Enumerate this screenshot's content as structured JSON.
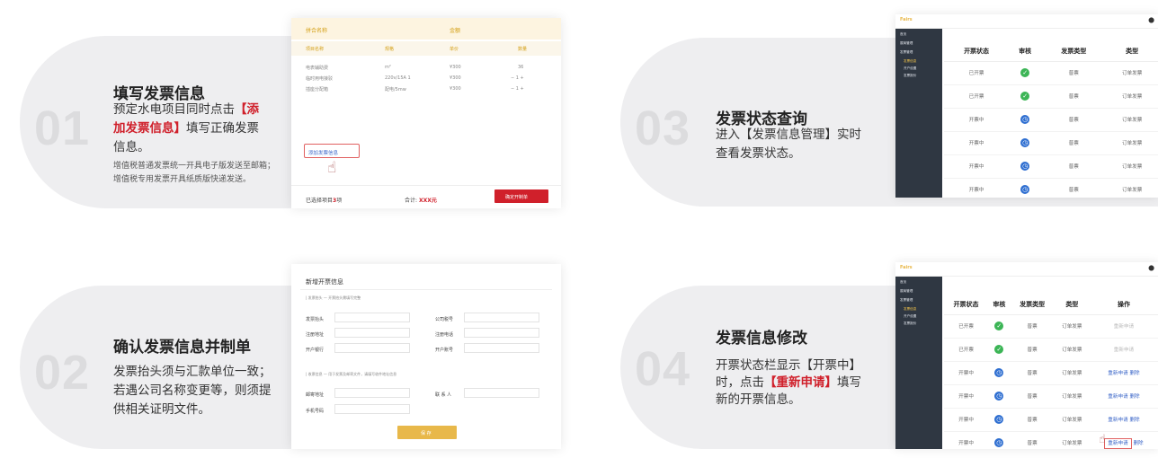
{
  "steps": [
    {
      "num": "01",
      "title": "填写发票信息",
      "desc_pre": "预定水电项目同时点击",
      "desc_hl": "【添加发票信息】",
      "desc_post": "填写正确发票信息。",
      "note": "增值税普通发票统一开具电子版发送至邮箱；增值税专用发票开具纸质版快递发送。"
    },
    {
      "num": "02",
      "title": "确认发票信息并制单",
      "desc": "发票抬头须与汇款单位一致；若遇公司名称变更等，则须提供相关证明文件。"
    },
    {
      "num": "03",
      "title": "发票状态查询",
      "desc": "进入【发票信息管理】实时查看发票状态。"
    },
    {
      "num": "04",
      "title": "发票信息修改",
      "desc_pre": "开票状态栏显示【开票中】时，点击",
      "desc_hl": "【重新申请】",
      "desc_post": "填写新的开票信息。"
    }
  ],
  "card1": {
    "head_left": "拼合名称",
    "head_right": "金额",
    "cols": [
      "项目名称",
      "规格",
      "单价",
      "数量"
    ],
    "rows": [
      [
        "电表辅助费",
        "m²",
        "¥300",
        "36"
      ],
      [
        "临时用电接驳",
        "220v/15A 1",
        "¥300",
        "− 1 +"
      ],
      [
        "插座分配箱",
        "配电/5mw",
        "¥300",
        "− 1 +"
      ]
    ],
    "add_link": "添加发票信息",
    "footer_left_pre": "已选择项目",
    "footer_left_count": "3",
    "footer_left_post": "项",
    "total_label": "合计:",
    "total_value": "XXX元",
    "confirm": "确定开制单"
  },
  "card2": {
    "title": "新增开票信息",
    "sec1": "| 发票抬头 — 开票抬头需填写完整",
    "fields_l": [
      "发票抬头",
      "注册地址",
      "开户银行"
    ],
    "fields_r": [
      "公司税号",
      "注册电话",
      "开户账号"
    ],
    "sec2": "| 收票信息 — 用于发票及邮寄文件，请填写收件地址信息",
    "fields_l2": [
      "邮寄地址",
      "手机号码"
    ],
    "fields_r2": [
      "联 系 人"
    ],
    "save": "保 存"
  },
  "win3": {
    "cols": [
      "开票状态",
      "审核",
      "发票类型",
      "类型"
    ],
    "rows": [
      {
        "status": "已开票",
        "audit": "ok",
        "kind": "普票",
        "type": "订单发票"
      },
      {
        "status": "已开票",
        "audit": "ok",
        "kind": "普票",
        "type": "订单发票"
      },
      {
        "status": "开票中",
        "audit": "wait",
        "kind": "普票",
        "type": "订单发票"
      },
      {
        "status": "开票中",
        "audit": "wait",
        "kind": "普票",
        "type": "订单发票"
      },
      {
        "status": "开票中",
        "audit": "wait",
        "kind": "普票",
        "type": "订单发票"
      },
      {
        "status": "开票中",
        "audit": "wait",
        "kind": "普票",
        "type": "订单发票"
      }
    ],
    "side": [
      "首页",
      "展商管理",
      "发票管理",
      "发票信息",
      "开户设置",
      "发票报价"
    ]
  },
  "win4": {
    "cols": [
      "开票状态",
      "审核",
      "发票类型",
      "类型",
      "操作"
    ],
    "rows": [
      {
        "status": "已开票",
        "audit": "ok",
        "kind": "普票",
        "type": "订单发票",
        "op1": "重新申请",
        "op2": ""
      },
      {
        "status": "已开票",
        "audit": "ok",
        "kind": "普票",
        "type": "订单发票",
        "op1": "重新申请",
        "op2": ""
      },
      {
        "status": "开票中",
        "audit": "wait",
        "kind": "普票",
        "type": "订单发票",
        "op1": "重新申请",
        "op2": "删除"
      },
      {
        "status": "开票中",
        "audit": "wait",
        "kind": "普票",
        "type": "订单发票",
        "op1": "重新申请",
        "op2": "删除"
      },
      {
        "status": "开票中",
        "audit": "wait",
        "kind": "普票",
        "type": "订单发票",
        "op1": "重新申请",
        "op2": "删除"
      },
      {
        "status": "开票中",
        "audit": "wait",
        "kind": "普票",
        "type": "订单发票",
        "op1": "重新申请",
        "op2": "删除"
      }
    ],
    "side": [
      "首页",
      "展商管理",
      "发票管理",
      "发票信息",
      "开户设置",
      "发票报价"
    ]
  },
  "colors": {
    "accent_red": "#d0202b",
    "gold": "#e8b84a",
    "link_blue": "#3c67c9",
    "success": "#3cb556",
    "pending": "#2f6fd1",
    "sidebar": "#2f3742"
  }
}
